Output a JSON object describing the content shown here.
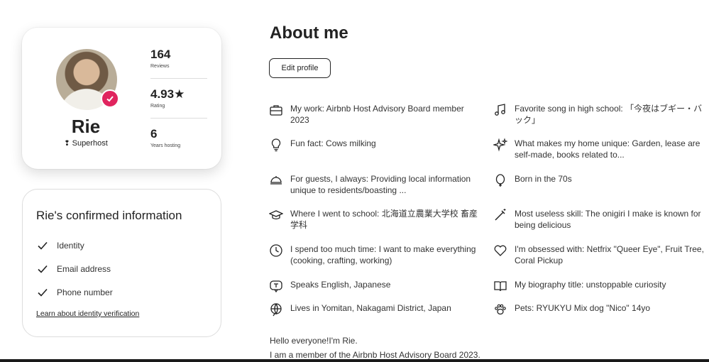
{
  "host": {
    "name": "Rie",
    "badge": "Superhost",
    "stats": [
      {
        "value": "164",
        "label": "Reviews"
      },
      {
        "value": "4.93★",
        "label": "Rating"
      },
      {
        "value": "6",
        "label": "Years hosting"
      }
    ]
  },
  "confirmed": {
    "title": "Rie's confirmed information",
    "items": [
      "Identity",
      "Email address",
      "Phone number"
    ],
    "link": "Learn about identity verification"
  },
  "about": {
    "title": "About me",
    "edit_label": "Edit profile",
    "facts": [
      {
        "icon": "briefcase-icon",
        "text": "My work: Airbnb Host Advisory Board member 2023"
      },
      {
        "icon": "music-note-icon",
        "text": "Favorite song in high school: 「今夜はブギー・バック」"
      },
      {
        "icon": "lightbulb-icon",
        "text": "Fun fact: Cows milking"
      },
      {
        "icon": "sparkles-icon",
        "text": "What makes my home unique: Garden, lease are self-made, books related to..."
      },
      {
        "icon": "cloche-icon",
        "text": "For guests, I always: Providing local information unique to residents/boasting ..."
      },
      {
        "icon": "balloon-icon",
        "text": "Born in the 70s"
      },
      {
        "icon": "graduation-cap-icon",
        "text": "Where I went to school: 北海道立農業大学校 畜産学科"
      },
      {
        "icon": "magic-wand-icon",
        "text": "Most useless skill: The onigiri I make is known for being delicious"
      },
      {
        "icon": "clock-icon",
        "text": "I spend too much time: I want to make everything (cooking, crafting, working)"
      },
      {
        "icon": "heart-icon",
        "text": "I'm obsessed with: Netfrix \"Queer Eye\", Fruit Tree, Coral Pickup"
      },
      {
        "icon": "speech-bubble-icon",
        "text": "Speaks English, Japanese"
      },
      {
        "icon": "book-icon",
        "text": "My biography title: unstoppable curiosity"
      },
      {
        "icon": "globe-icon",
        "text": "Lives in Yomitan, Nakagami District, Japan"
      },
      {
        "icon": "paw-icon",
        "text": "Pets: RYUKYU Mix dog \"Nico\" 14yo"
      }
    ],
    "bio": [
      "Hello everyone!I'm Rie.",
      "I am a member of the Airbnb Host Advisory Board 2023."
    ]
  },
  "colors": {
    "accent": "#e0245e",
    "text": "#222222",
    "border": "#dddddd"
  }
}
